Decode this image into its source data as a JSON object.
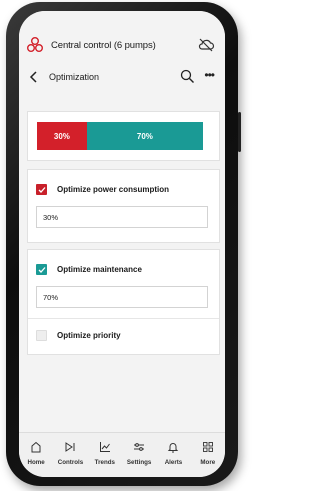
{
  "header": {
    "app_title": "Central control (6 pumps)",
    "page_title": "Optimization"
  },
  "split": {
    "left_label": "30%",
    "right_label": "70%",
    "left_fraction": 0.3,
    "right_fraction": 0.7,
    "left_color": "#d3202a",
    "right_color": "#1a9a95"
  },
  "options": [
    {
      "label": "Optimize power consumption",
      "checked": true,
      "check_color": "#c8202a",
      "value": "30%"
    },
    {
      "label": "Optimize maintenance",
      "checked": true,
      "check_color": "#1a9a95",
      "value": "70%"
    },
    {
      "label": "Optimize priority",
      "checked": false
    }
  ],
  "tabs": [
    {
      "label": "Home",
      "icon": "home-icon"
    },
    {
      "label": "Controls",
      "icon": "controls-icon"
    },
    {
      "label": "Trends",
      "icon": "trends-icon"
    },
    {
      "label": "Settings",
      "icon": "settings-icon"
    },
    {
      "label": "Alerts",
      "icon": "bell-icon"
    },
    {
      "label": "More",
      "icon": "grid-icon"
    }
  ]
}
